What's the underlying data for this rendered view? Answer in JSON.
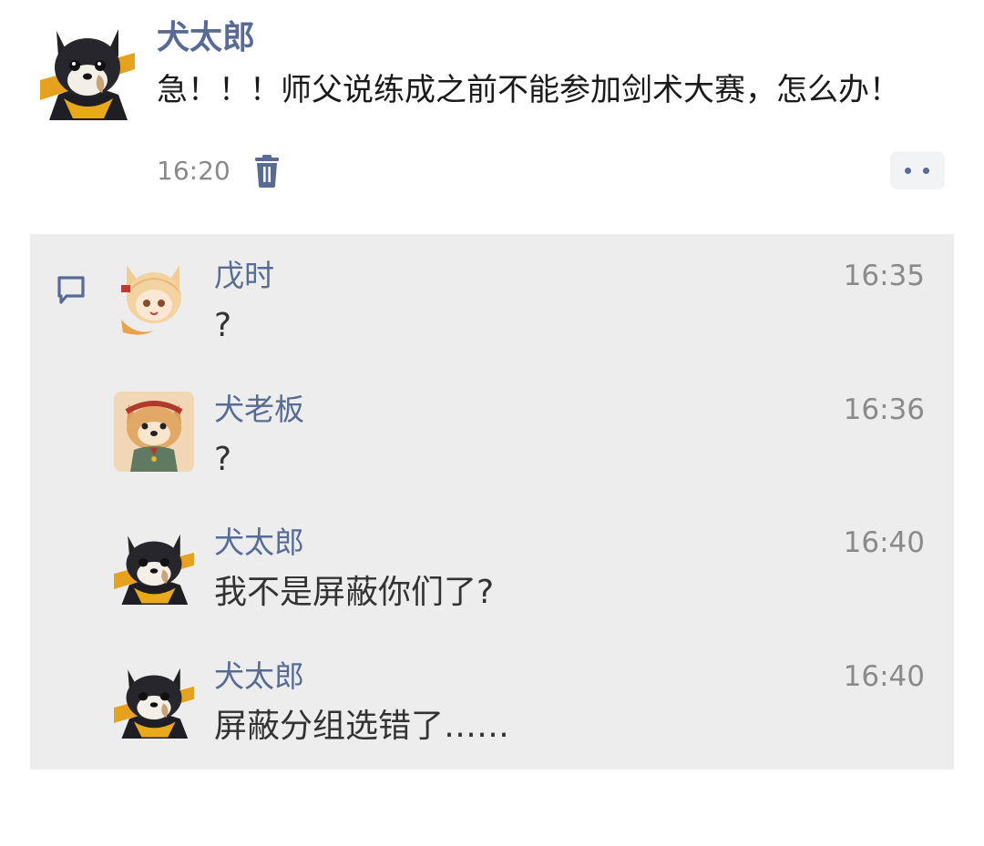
{
  "post": {
    "author": "犬太郎",
    "text": "急！！！师父说练成之前不能参加剑术大赛，怎么办！",
    "time": "16:20",
    "avatar_icon": "black-shiba-avatar-icon",
    "delete_icon": "trash-icon",
    "more_icon": "more-dots-icon"
  },
  "comments": [
    {
      "author": "戊时",
      "text": "?",
      "time": "16:35",
      "avatar_icon": "fox-girl-avatar-icon"
    },
    {
      "author": "犬老板",
      "text": "?",
      "time": "16:36",
      "avatar_icon": "shiba-boss-avatar-icon"
    },
    {
      "author": "犬太郎",
      "text": "我不是屏蔽你们了?",
      "time": "16:40",
      "avatar_icon": "black-shiba-avatar-icon"
    },
    {
      "author": "犬太郎",
      "text": "屏蔽分组选错了……",
      "time": "16:40",
      "avatar_icon": "black-shiba-avatar-icon"
    }
  ],
  "colors": {
    "name_link": "#576b95",
    "comment_bg": "#ededed",
    "timestamp": "#8a8a8a"
  }
}
